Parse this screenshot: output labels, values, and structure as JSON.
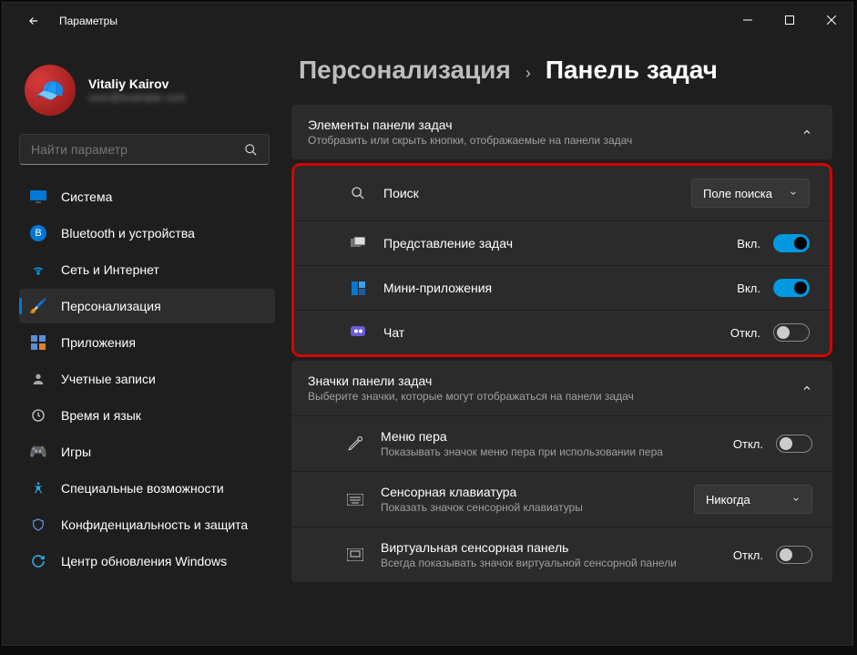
{
  "window": {
    "title": "Параметры"
  },
  "profile": {
    "name": "Vitaliy Kairov",
    "email": "user@example.com"
  },
  "search": {
    "placeholder": "Найти параметр"
  },
  "nav": {
    "items": [
      {
        "label": "Система"
      },
      {
        "label": "Bluetooth и устройства"
      },
      {
        "label": "Сеть и Интернет"
      },
      {
        "label": "Персонализация"
      },
      {
        "label": "Приложения"
      },
      {
        "label": "Учетные записи"
      },
      {
        "label": "Время и язык"
      },
      {
        "label": "Игры"
      },
      {
        "label": "Специальные возможности"
      },
      {
        "label": "Конфиденциальность и защита"
      },
      {
        "label": "Центр обновления Windows"
      }
    ]
  },
  "breadcrumb": {
    "parent": "Персонализация",
    "current": "Панель задач"
  },
  "section1": {
    "title": "Элементы панели задач",
    "sub": "Отобразить или скрыть кнопки, отображаемые на панели задач",
    "rows": [
      {
        "label": "Поиск",
        "dropdown": "Поле поиска"
      },
      {
        "label": "Представление задач",
        "state": "Вкл."
      },
      {
        "label": "Мини-приложения",
        "state": "Вкл."
      },
      {
        "label": "Чат",
        "state": "Откл."
      }
    ]
  },
  "section2": {
    "title": "Значки панели задач",
    "sub": "Выберите значки, которые могут отображаться на панели задач",
    "rows": [
      {
        "label": "Меню пера",
        "sub": "Показывать значок меню пера при использовании пера",
        "state": "Откл."
      },
      {
        "label": "Сенсорная клавиатура",
        "sub": "Показать значок сенсорной клавиатуры",
        "dropdown": "Никогда"
      },
      {
        "label": "Виртуальная сенсорная панель",
        "sub": "Всегда показывать значок виртуальной сенсорной панели",
        "state": "Откл."
      }
    ]
  }
}
